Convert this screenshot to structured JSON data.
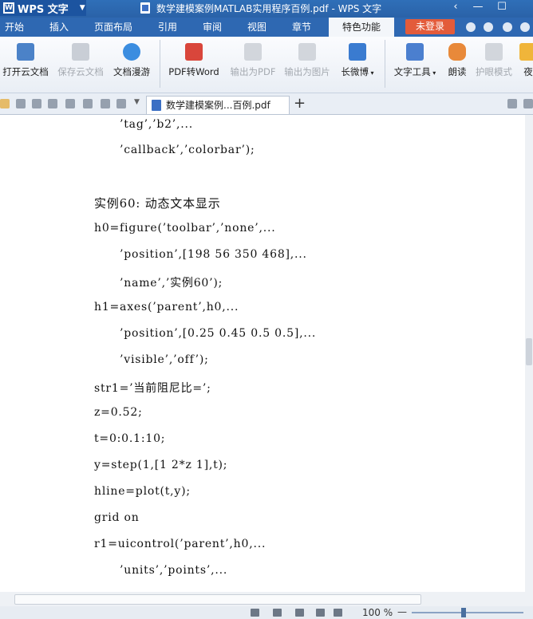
{
  "app": {
    "name": "WPS 文字",
    "window_title": "数学建模案例MATLAB实用程序百例.pdf - WPS 文字"
  },
  "window_controls": [
    "‹",
    "—",
    "☐"
  ],
  "menu": {
    "items": [
      "开始",
      "插入",
      "页面布局",
      "引用",
      "审阅",
      "视图",
      "章节",
      "特色功能"
    ],
    "active": "特色功能",
    "login_label": "未登录"
  },
  "ribbon": {
    "buttons": [
      {
        "label": "打开云文档",
        "icon": "cloud-open-icon",
        "enabled": true
      },
      {
        "label": "保存云文档",
        "icon": "cloud-save-icon",
        "enabled": false
      },
      {
        "label": "文档漫游",
        "icon": "cloud-roam-icon",
        "enabled": true
      },
      {
        "label": "PDF转Word",
        "icon": "pdf-to-word-icon",
        "enabled": true
      },
      {
        "label": "输出为PDF",
        "icon": "export-pdf-icon",
        "enabled": false
      },
      {
        "label": "输出为图片",
        "icon": "export-image-icon",
        "enabled": false
      },
      {
        "label": "长微博",
        "icon": "weibo-icon",
        "enabled": true
      },
      {
        "label": "文字工具",
        "icon": "text-tools-icon",
        "enabled": true
      },
      {
        "label": "朗读",
        "icon": "read-aloud-icon",
        "enabled": true
      },
      {
        "label": "护眼模式",
        "icon": "eye-care-icon",
        "enabled": false
      },
      {
        "label": "夜",
        "icon": "night-mode-icon",
        "enabled": true
      }
    ]
  },
  "tabs": {
    "document_tab": "数学建模案例...百例.pdf",
    "new_tab": "+"
  },
  "document": {
    "lines": [
      "’tag’,’b2’,...",
      "’callback’,’colorbar’);",
      "实例60: 动态文本显示",
      "h0=figure(’toolbar’,’none’,...",
      "’position’,[198 56 350 468],...",
      "’name’,’实例60’);",
      "h1=axes(’parent’,h0,...",
      "’position’,[0.25 0.45 0.5 0.5],...",
      "’visible’,’off’);",
      "str1=’当前阻尼比=’;",
      "z=0.52;",
      "t=0:0.1:10;",
      "y=step(1,[1 2*z 1],t);",
      "hline=plot(t,y);",
      "grid on",
      "r1=uicontrol(’parent’,h0,...",
      "’units’,’points’,..."
    ]
  },
  "status_bar": {
    "zoom": "100 %",
    "zoom_fraction": 0.5
  },
  "colors": {
    "title_bar": "#2f6fb8",
    "menu_bar": "#2e68b2",
    "login_button": "#e35b3a"
  }
}
